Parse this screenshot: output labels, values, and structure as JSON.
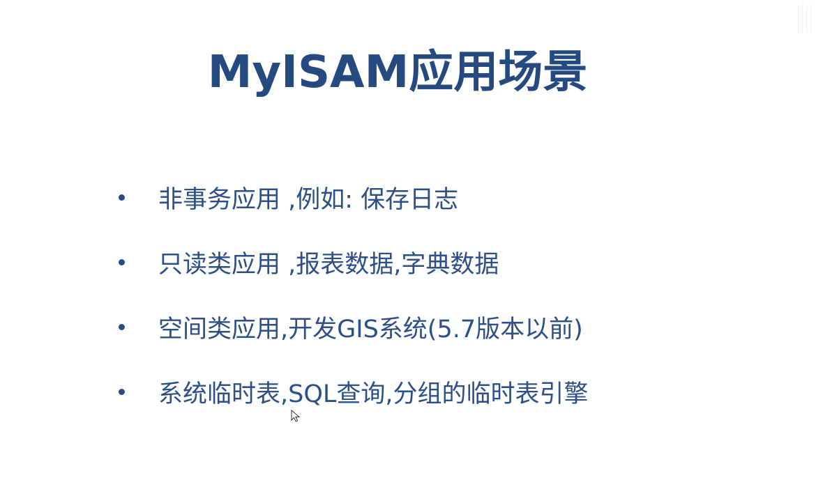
{
  "slide": {
    "title": "MyISAM应用场景",
    "bullets": [
      "非事务应用 ,例如: 保存日志",
      "只读类应用 ,报表数据,字典数据",
      "空间类应用,开发GIS系统(5.7版本以前)",
      "系统临时表,SQL查询,分组的临时表引擎"
    ]
  },
  "colors": {
    "title": "#244a80",
    "text": "#2b4f86",
    "background": "#ffffff"
  },
  "icons": {
    "cursor": "mouse-pointer-icon",
    "bullet": "bullet-dot-icon"
  }
}
